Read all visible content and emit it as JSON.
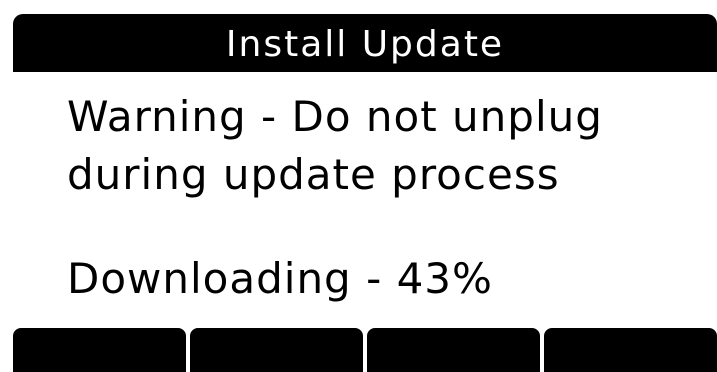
{
  "header": {
    "title": "Install Update"
  },
  "message": {
    "warning_line1": "Warning - Do not unplug",
    "warning_line2": "during update process",
    "status": "Downloading - 43%"
  },
  "progress": {
    "percent": 43
  },
  "softkeys": [
    {
      "label": ""
    },
    {
      "label": ""
    },
    {
      "label": ""
    },
    {
      "label": ""
    }
  ],
  "colors": {
    "background": "#ffffff",
    "bars": "#000000",
    "text": "#000000",
    "inverse_text": "#ffffff"
  }
}
